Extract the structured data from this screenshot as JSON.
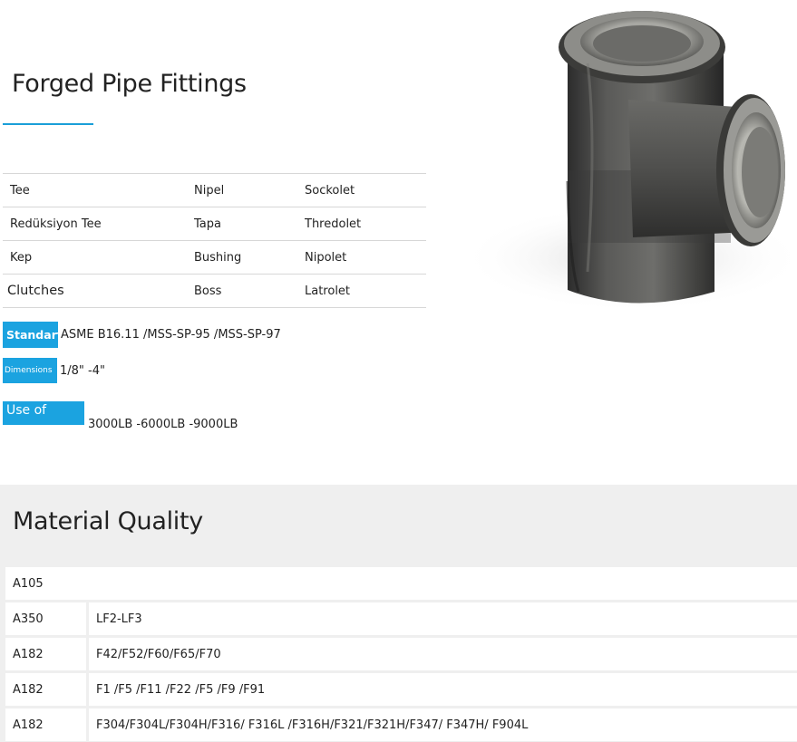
{
  "title": "Forged Pipe Fittings",
  "fittings": [
    [
      "Tee",
      "Nipel",
      "Sockolet"
    ],
    [
      "Redüksiyon Tee",
      "Tapa",
      "Thredolet"
    ],
    [
      "Kep",
      "Bushing",
      "Nipolet"
    ],
    [
      "Clutches",
      "Boss",
      "Latrolet"
    ]
  ],
  "specs": {
    "standart": {
      "label": "Standart",
      "value": "ASME B16.11 /MSS-SP-95 /MSS-SP-97"
    },
    "dimensions": {
      "label": "Dimensions",
      "value": "1/8\" -4\""
    },
    "use_of": {
      "label": "Use of",
      "value": "3000LB -6000LB -9000LB"
    }
  },
  "product_image": {
    "subject": "forged threaded tee fitting"
  },
  "material_section": {
    "title": "Material Quality",
    "rows": [
      {
        "grade": "A105",
        "spec": ""
      },
      {
        "grade": "A350",
        "spec": "LF2-LF3"
      },
      {
        "grade": "A182",
        "spec": "F42/F52/F60/F65/F70"
      },
      {
        "grade": "A182",
        "spec": "F1 /F5 /F11 /F22 /F5 /F9 /F91"
      },
      {
        "grade": "A182",
        "spec": "F304/F304L/F304H/F316/ F316L /F316H/F321/F321H/F347/ F347H/ F904L"
      }
    ]
  },
  "colors": {
    "accent": "#1ba3e0",
    "section_bg": "#efefef",
    "divider": "#d7d7d7"
  }
}
